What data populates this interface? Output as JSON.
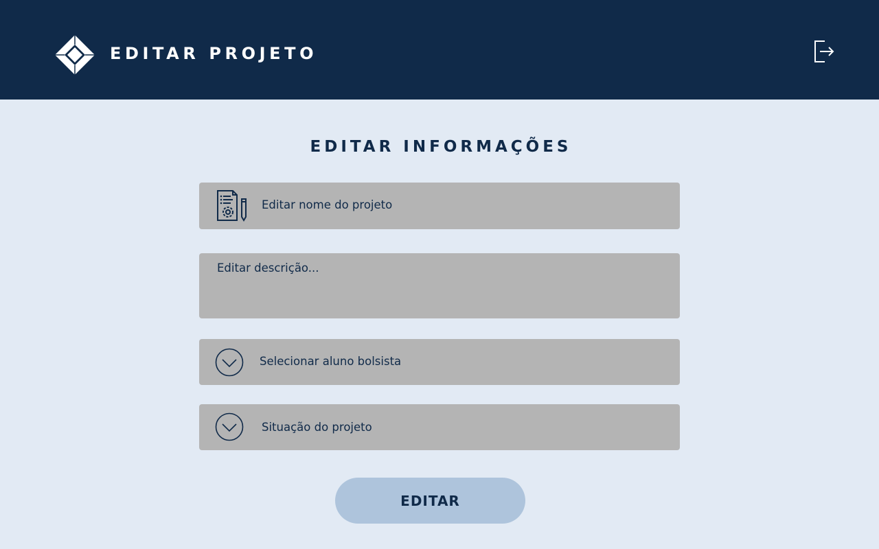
{
  "header": {
    "title": "EDITAR PROJETO",
    "logo_icon": "diamond-logo-icon",
    "logout_icon": "logout-icon",
    "background_color": "#102a49"
  },
  "main": {
    "section_title": "EDITAR INFORMAÇÕES",
    "fields": {
      "name": {
        "placeholder": "Editar nome do projeto",
        "icon": "document-settings-icon"
      },
      "description": {
        "placeholder": "Editar descrição..."
      },
      "scholarship_student": {
        "placeholder": "Selecionar aluno bolsista",
        "icon": "chevron-down-circle-icon"
      },
      "project_status": {
        "placeholder": "Situação do projeto",
        "icon": "chevron-down-circle-icon"
      }
    },
    "submit_label": "EDITAR"
  },
  "colors": {
    "page_background": "#e2eaf4",
    "field_background": "#b4b4b4",
    "button_background": "#aec4dc",
    "text_dark": "#102a49"
  }
}
